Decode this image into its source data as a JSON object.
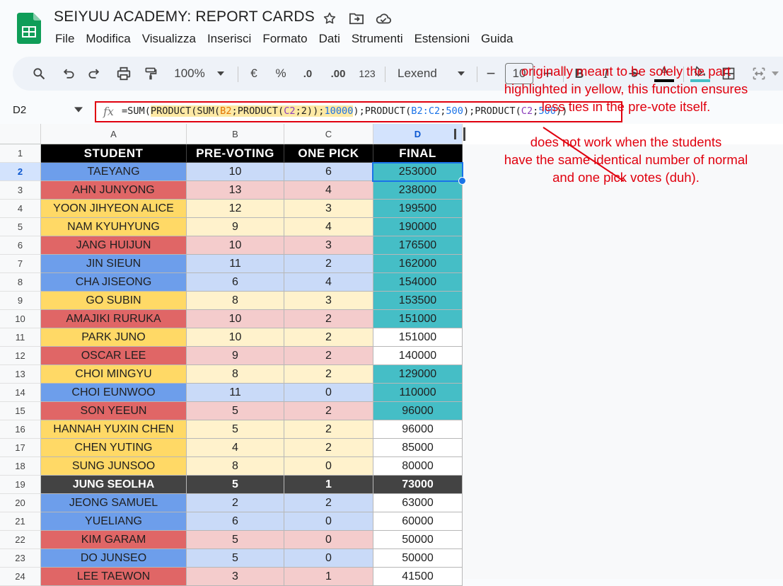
{
  "doc": {
    "title": "SEIYUU ACADEMY: REPORT CARDS"
  },
  "menu": [
    "File",
    "Modifica",
    "Visualizza",
    "Inserisci",
    "Formato",
    "Dati",
    "Strumenti",
    "Estensioni",
    "Guida"
  ],
  "toolbar": {
    "zoom": "100%",
    "currency": "€",
    "percent": "%",
    "dec_decrease": ".0",
    "dec_increase": ".00",
    "number_format": "123",
    "font": "Lexend",
    "font_size": "10",
    "minus": "−",
    "plus": "+",
    "bold": "B",
    "italic": "I",
    "text_color_letter": "A"
  },
  "formula_bar": {
    "cell_ref": "D2",
    "fx": "fx",
    "parts": [
      "=SUM(",
      "PRODUCT(SUM(",
      "B2",
      ";PRODUCT(",
      "C2",
      ";2));",
      "10000",
      ")",
      ";PRODUCT(",
      "B2:C2",
      ";",
      "500",
      ");PRODUCT(",
      "C2",
      ";",
      "500",
      "))"
    ]
  },
  "columns": [
    "A",
    "B",
    "C",
    "D"
  ],
  "header": [
    "STUDENT",
    "PRE-VOTING",
    "ONE PICK",
    "FINAL"
  ],
  "rows": [
    {
      "n": "2",
      "student": "TAEYANG",
      "pre": "10",
      "pick": "6",
      "final": "253000",
      "team": "blue",
      "teal": true
    },
    {
      "n": "3",
      "student": "AHN JUNYONG",
      "pre": "13",
      "pick": "4",
      "final": "238000",
      "team": "red",
      "teal": true
    },
    {
      "n": "4",
      "student": "YOON JIHYEON ALICE",
      "pre": "12",
      "pick": "3",
      "final": "199500",
      "team": "yellow",
      "teal": true
    },
    {
      "n": "5",
      "student": "NAM KYUHYUNG",
      "pre": "9",
      "pick": "4",
      "final": "190000",
      "team": "yellow",
      "teal": true
    },
    {
      "n": "6",
      "student": "JANG HUIJUN",
      "pre": "10",
      "pick": "3",
      "final": "176500",
      "team": "red",
      "teal": true
    },
    {
      "n": "7",
      "student": "JIN SIEUN",
      "pre": "11",
      "pick": "2",
      "final": "162000",
      "team": "blue",
      "teal": true
    },
    {
      "n": "8",
      "student": "CHA JISEONG",
      "pre": "6",
      "pick": "4",
      "final": "154000",
      "team": "blue",
      "teal": true
    },
    {
      "n": "9",
      "student": "GO SUBIN",
      "pre": "8",
      "pick": "3",
      "final": "153500",
      "team": "yellow",
      "teal": true
    },
    {
      "n": "10",
      "student": "AMAJIKI RURUKA",
      "pre": "10",
      "pick": "2",
      "final": "151000",
      "team": "red",
      "teal": true
    },
    {
      "n": "11",
      "student": "PARK JUNO",
      "pre": "10",
      "pick": "2",
      "final": "151000",
      "team": "yellow",
      "teal": false
    },
    {
      "n": "12",
      "student": "OSCAR LEE",
      "pre": "9",
      "pick": "2",
      "final": "140000",
      "team": "red",
      "teal": false
    },
    {
      "n": "13",
      "student": "CHOI MINGYU",
      "pre": "8",
      "pick": "2",
      "final": "129000",
      "team": "yellow",
      "teal": true
    },
    {
      "n": "14",
      "student": "CHOI EUNWOO",
      "pre": "11",
      "pick": "0",
      "final": "110000",
      "team": "blue",
      "teal": true
    },
    {
      "n": "15",
      "student": "SON YEEUN",
      "pre": "5",
      "pick": "2",
      "final": "96000",
      "team": "red",
      "teal": true
    },
    {
      "n": "16",
      "student": "HANNAH YUXIN CHEN",
      "pre": "5",
      "pick": "2",
      "final": "96000",
      "team": "yellow",
      "teal": false
    },
    {
      "n": "17",
      "student": "CHEN YUTING",
      "pre": "4",
      "pick": "2",
      "final": "85000",
      "team": "yellow",
      "teal": false
    },
    {
      "n": "18",
      "student": "SUNG JUNSOO",
      "pre": "8",
      "pick": "0",
      "final": "80000",
      "team": "yellow",
      "teal": false
    },
    {
      "n": "19",
      "student": "JUNG SEOLHA",
      "pre": "5",
      "pick": "1",
      "final": "73000",
      "team": "dark",
      "teal": false
    },
    {
      "n": "20",
      "student": "JEONG SAMUEL",
      "pre": "2",
      "pick": "2",
      "final": "63000",
      "team": "blue",
      "teal": false
    },
    {
      "n": "21",
      "student": "YUELIANG",
      "pre": "6",
      "pick": "0",
      "final": "60000",
      "team": "blue",
      "teal": false
    },
    {
      "n": "22",
      "student": "KIM GARAM",
      "pre": "5",
      "pick": "0",
      "final": "50000",
      "team": "red",
      "teal": false
    },
    {
      "n": "23",
      "student": "DO JUNSEO",
      "pre": "5",
      "pick": "0",
      "final": "50000",
      "team": "blue",
      "teal": false
    },
    {
      "n": "24",
      "student": "LEE TAEWON",
      "pre": "3",
      "pick": "1",
      "final": "41500",
      "team": "red",
      "teal": false
    }
  ],
  "annotation": {
    "line1": "originally meant to be solely the part",
    "line2": "highlighted in yellow, this function ensures",
    "line3": "less ties in the pre-vote itself.",
    "line4": "does not work when the students",
    "line5": "have the same identical number of normal",
    "line6": "and one pick votes (duh)."
  },
  "colors": {
    "blue_dark": "#6d9eeb",
    "blue_light": "#c9daf8",
    "red_dark": "#e06666",
    "red_light": "#f4cccc",
    "yellow_dark": "#ffd966",
    "yellow_light": "#fff2cc",
    "dark_dark": "#434343",
    "dark_light": "#434343",
    "teal": "#45bec6",
    "annotation": "#e0000e",
    "formula_border": "#e0000e"
  }
}
